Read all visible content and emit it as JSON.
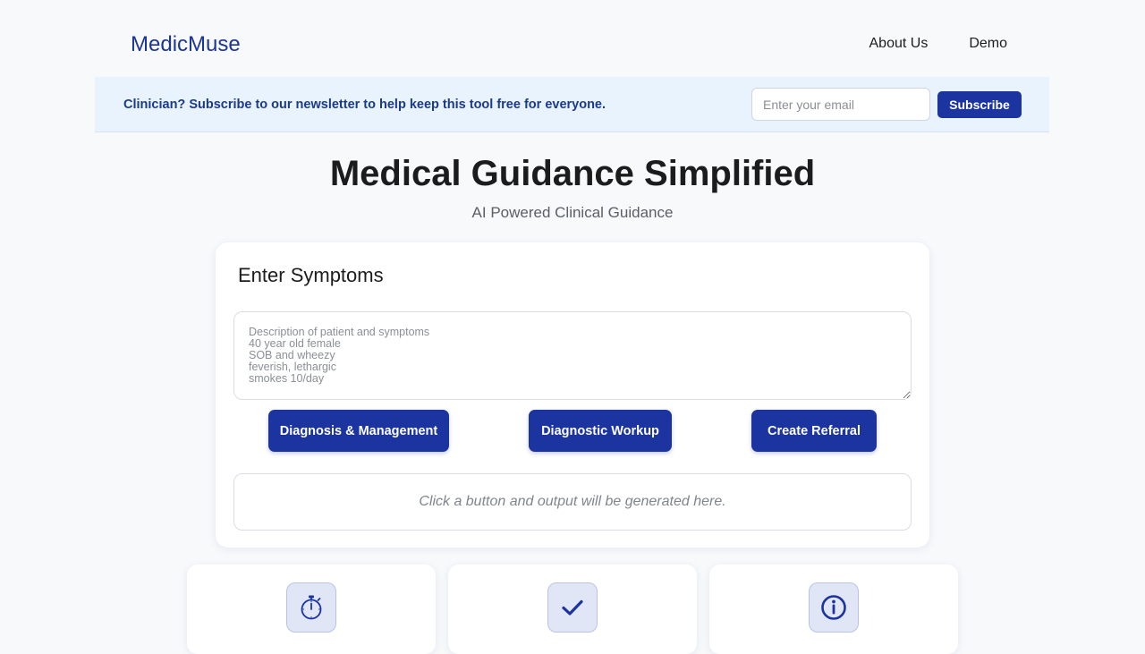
{
  "brand": {
    "name": "MedicMuse",
    "color": "#1c3596"
  },
  "nav": {
    "items": [
      {
        "label": "About Us"
      },
      {
        "label": "Demo"
      }
    ]
  },
  "banner": {
    "text": "Clinician? Subscribe to our newsletter to help keep this tool free for everyone.",
    "email_placeholder": "Enter your email",
    "subscribe_label": "Subscribe"
  },
  "hero": {
    "title": "Medical Guidance Simplified",
    "subtitle": "AI Powered Clinical Guidance"
  },
  "symptoms_card": {
    "title": "Enter Symptoms",
    "placeholder": "Description of patient and symptoms\n40 year old female\nSOB and wheezy\nfeverish, lethargic\nsmokes 10/day",
    "value": "",
    "buttons": {
      "diagnosis": "Diagnosis & Management",
      "workup": "Diagnostic Workup",
      "referral": "Create Referral"
    },
    "output_placeholder": "Click a button and output will be generated here."
  },
  "features": [
    {
      "icon": "stopwatch-icon"
    },
    {
      "icon": "checkmark-icon"
    },
    {
      "icon": "info-icon"
    }
  ],
  "colors": {
    "accent": "#1c34a0",
    "banner_bg": "#e8f3fd",
    "page_bg": "#f7f9fb"
  }
}
